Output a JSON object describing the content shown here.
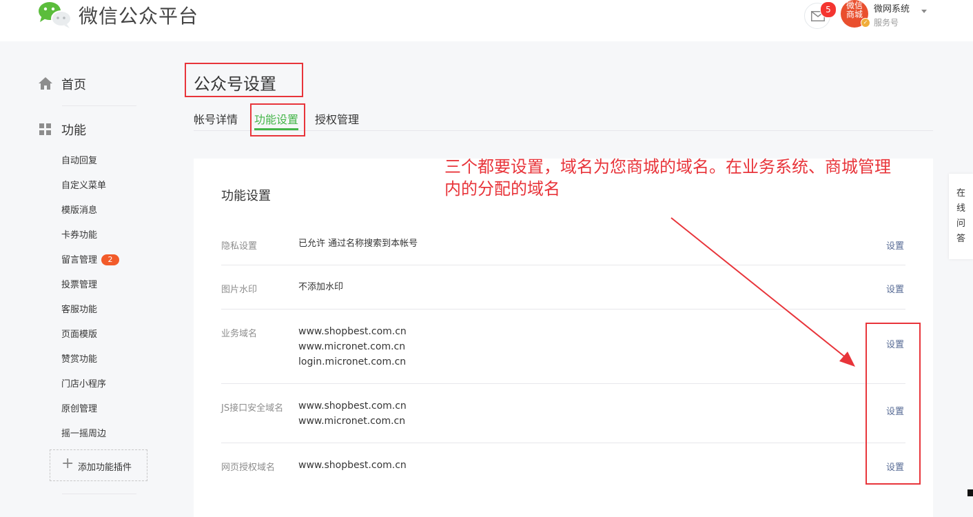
{
  "header": {
    "platform_title": "微信公众平台",
    "mail_count": "5",
    "avatar_lines": [
      "微信",
      "商城"
    ],
    "account_name": "微网系统",
    "account_type": "服务号"
  },
  "sidebar": {
    "home_label": "首页",
    "function_label": "功能",
    "items": [
      {
        "label": "自动回复"
      },
      {
        "label": "自定义菜单"
      },
      {
        "label": "模版消息"
      },
      {
        "label": "卡券功能"
      },
      {
        "label": "留言管理",
        "badge": "2"
      },
      {
        "label": "投票管理"
      },
      {
        "label": "客服功能"
      },
      {
        "label": "页面模版"
      },
      {
        "label": "赞赏功能"
      },
      {
        "label": "门店小程序"
      },
      {
        "label": "原创管理"
      },
      {
        "label": "摇一摇周边"
      }
    ],
    "add_plugin_label": "添加功能插件"
  },
  "main": {
    "page_title": "公众号设置",
    "tabs": [
      {
        "label": "帐号详情",
        "active": false
      },
      {
        "label": "功能设置",
        "active": true
      },
      {
        "label": "授权管理",
        "active": false
      }
    ],
    "panel_title": "功能设置",
    "rows": [
      {
        "label": "隐私设置",
        "values": [
          "已允许 通过名称搜索到本帐号"
        ],
        "action": "设置"
      },
      {
        "label": "图片水印",
        "values": [
          "不添加水印"
        ],
        "action": "设置"
      },
      {
        "label": "业务域名",
        "values": [
          "www.shopbest.com.cn",
          "www.micronet.com.cn",
          "login.micronet.com.cn"
        ],
        "action": "设置"
      },
      {
        "label": "JS接口安全域名",
        "values": [
          "www.shopbest.com.cn",
          "www.micronet.com.cn"
        ],
        "action": "设置"
      },
      {
        "label": "网页授权域名",
        "values": [
          "www.shopbest.com.cn"
        ],
        "action": "设置"
      }
    ]
  },
  "annotation": {
    "line1": "三个都要设置，域名为您商城的域名。在业务系统、商城管理",
    "line2": "内的分配的域名"
  },
  "float_qa": [
    "在",
    "线",
    "问",
    "答"
  ],
  "colors": {
    "accent_green": "#44b549",
    "link_blue": "#576b95",
    "annotation_red": "#e8343a",
    "badge_red": "#f43530"
  }
}
